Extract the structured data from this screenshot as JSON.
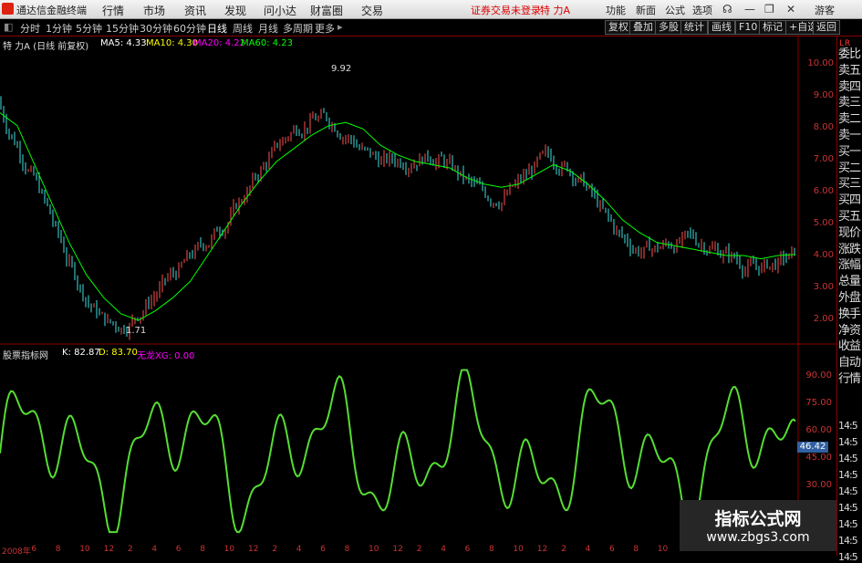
{
  "app": {
    "title": "通达信金融终端",
    "menus": [
      "行情",
      "市场",
      "资讯",
      "发现",
      "问小达",
      "财富圈",
      "交易"
    ],
    "login_notice": "证券交易未登录",
    "stock_name_top": "特 力A",
    "right_menus": [
      "功能",
      "新面",
      "公式",
      "选项"
    ],
    "guest": "游客"
  },
  "periods": [
    "分时",
    "1分钟",
    "5分钟",
    "15分钟",
    "30分钟",
    "60分钟",
    "日线",
    "周线",
    "月线",
    "多周期",
    "更多"
  ],
  "selected_period": "日线",
  "toolbar_right": [
    "复权",
    "叠加",
    "多股",
    "统计",
    "画线",
    "F10",
    "标记",
    "+自选",
    "返回"
  ],
  "main_legend": {
    "name": "特 力A (日线 前复权)",
    "ma5": "MA5: 4.33",
    "ma10": "MA10: 4.30",
    "ma20": "MA20: 4.22",
    "ma60": "MA60: 4.23"
  },
  "colors": {
    "ma5": "#ffffff",
    "ma10": "#ffff00",
    "ma20": "#ff00ff",
    "ma60": "#00ff00",
    "axis": "#c33333",
    "kline": "#55dd33"
  },
  "price_axis": [
    "10.00",
    "9.00",
    "8.00",
    "7.00",
    "6.00",
    "5.00",
    "4.00",
    "3.00",
    "2.00"
  ],
  "annotations": {
    "high": "9.92",
    "low": "1.71"
  },
  "indicator_legend": {
    "name": "股票指标网",
    "k": "K: 82.87",
    "d": "D: 83.70",
    "xg": "无龙XG: 0.00"
  },
  "indicator_axis": [
    "90.00",
    "75.00",
    "60.00",
    "45.00",
    "30.00"
  ],
  "indicator_value_box": "46.42",
  "side_panel": [
    "委比",
    "卖五",
    "卖四",
    "卖三",
    "卖二",
    "卖一",
    "买一",
    "买二",
    "买三",
    "买四",
    "买五",
    "现价",
    "涨跌",
    "涨幅",
    "总量",
    "外盘",
    "换手",
    "净资",
    "收益",
    "自动",
    "行情"
  ],
  "side_times": [
    "14:5",
    "14:5",
    "14:5",
    "14:5",
    "14:5",
    "14:5",
    "14:5",
    "14:5",
    "14:5"
  ],
  "date_axis": [
    "2008年",
    "6",
    "8",
    "10",
    "12",
    "2",
    "4",
    "6",
    "8",
    "10",
    "12",
    "2",
    "4",
    "6",
    "8",
    "10",
    "12",
    "2",
    "4",
    "6",
    "8",
    "10",
    "12",
    "2",
    "4",
    "6",
    "8",
    "10",
    "12",
    "2",
    "4",
    "6",
    "8",
    "10"
  ],
  "watermark": {
    "line1": "指标公式网",
    "line2": "www.zbgs3.com"
  },
  "chart_data": {
    "type": "line",
    "series": [
      {
        "name": "MA60",
        "values": [
          8.6,
          8.2,
          7.0,
          5.8,
          4.6,
          3.6,
          2.9,
          2.4,
          2.2,
          2.5,
          2.9,
          3.4,
          4.2,
          5.0,
          5.8,
          6.5,
          7.1,
          7.5,
          7.9,
          8.2,
          8.3,
          8.1,
          7.6,
          7.3,
          7.1,
          7.0,
          6.9,
          6.6,
          6.4,
          6.3,
          6.4,
          6.7,
          7.0,
          6.8,
          6.4,
          5.9,
          5.3,
          4.9,
          4.6,
          4.5,
          4.4,
          4.3,
          4.2,
          4.2,
          4.1,
          4.2,
          4.23
        ]
      }
    ],
    "y_range": [
      1.5,
      10.5
    ],
    "indicator": {
      "k": 82.87,
      "d": 83.7,
      "y_range": [
        20,
        95
      ]
    }
  }
}
